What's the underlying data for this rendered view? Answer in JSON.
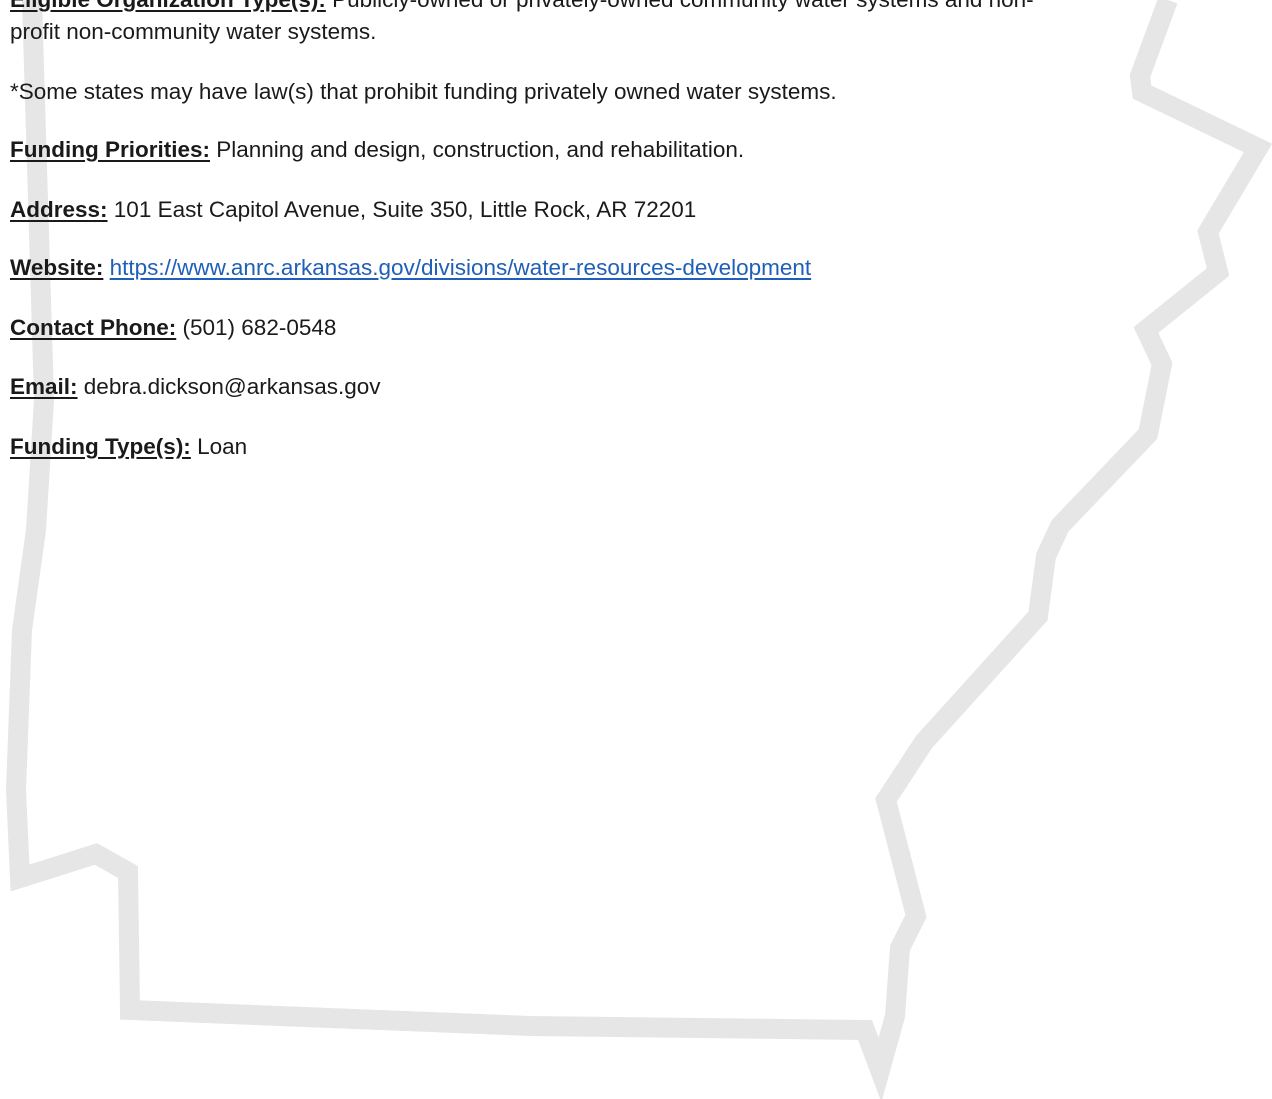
{
  "eligibility": {
    "label": "Eligible Organization Type(s):",
    "text_cut": "Publicly-owned or privately-owned community water systems and non-",
    "text_continued": "profit non-community water systems."
  },
  "note": "*Some states may have law(s) that prohibit funding privately owned water systems.",
  "fields": {
    "priorities": {
      "label": "Funding Priorities:",
      "value": "Planning and design, construction, and rehabilitation."
    },
    "address": {
      "label": "Address:",
      "value": "101 East Capitol Avenue, Suite 350, Little Rock, AR 72201"
    },
    "website": {
      "label": "Website:",
      "value": "https://www.anrc.arkansas.gov/divisions/water-resources-development"
    },
    "phone": {
      "label": "Contact Phone:",
      "value": "(501) 682-0548"
    },
    "email": {
      "label": "Email:",
      "value": "debra.dickson@arkansas.gov"
    },
    "funding_type": {
      "label": "Funding Type(s):",
      "value": "Loan"
    }
  },
  "watermark": {
    "color": "#e6e6e6",
    "shape": "arkansas-state-outline"
  }
}
